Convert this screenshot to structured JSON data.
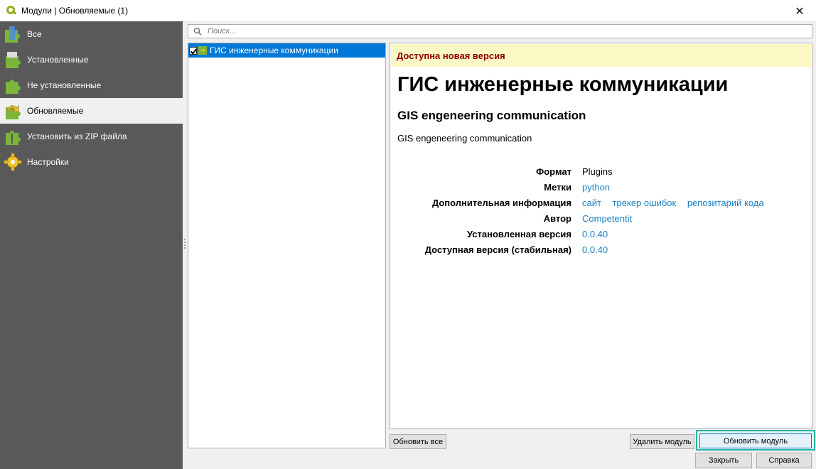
{
  "window": {
    "title": "Модули | Обновляемые (1)",
    "close_glyph": "✕"
  },
  "sidebar": {
    "items": [
      {
        "label": "Все",
        "icon": "puzzle-all-icon"
      },
      {
        "label": "Установленные",
        "icon": "puzzle-installed-icon"
      },
      {
        "label": "Не установленные",
        "icon": "puzzle-not-installed-icon"
      },
      {
        "label": "Обновляемые",
        "icon": "puzzle-upgradeable-icon",
        "active": true
      },
      {
        "label": "Установить из ZIP файла",
        "icon": "zip-install-icon"
      },
      {
        "label": "Настройки",
        "icon": "gear-icon"
      }
    ]
  },
  "search": {
    "placeholder": "Поиск...",
    "value": ""
  },
  "plugin_list": {
    "items": [
      {
        "label": "ГИС инженерные коммуникации",
        "checked": true,
        "selected": true
      }
    ]
  },
  "details": {
    "banner": "Доступна новая версия",
    "title": "ГИС инженерные коммуникации",
    "subtitle": "GIS engeneering communication",
    "description": "GIS engeneering communication",
    "meta": {
      "format_label": "Формат",
      "format_value": "Plugins",
      "tags_label": "Метки",
      "tags_value": "python",
      "more_info_label": "Дополнительная информация",
      "link_site": "сайт",
      "link_tracker": "трекер ошибок",
      "link_repo": "репозитарий кода",
      "author_label": "Автор",
      "author_value": "Competentit",
      "installed_label": "Установленная версия",
      "installed_value": "0.0.40",
      "available_label": "Доступная версия (стабильная)",
      "available_value": "0.0.40"
    }
  },
  "buttons": {
    "upgrade_all": "Обновить все",
    "uninstall": "Удалить модуль",
    "upgrade": "Обновить модуль",
    "close": "Закрыть",
    "help": "Справка"
  },
  "colors": {
    "sidebar_bg": "#595959",
    "selection": "#0078d7",
    "banner_bg": "#fcf8c3",
    "banner_text": "#8b0000",
    "link": "#1a7fc1",
    "focus_ring": "#2ab3a0"
  }
}
